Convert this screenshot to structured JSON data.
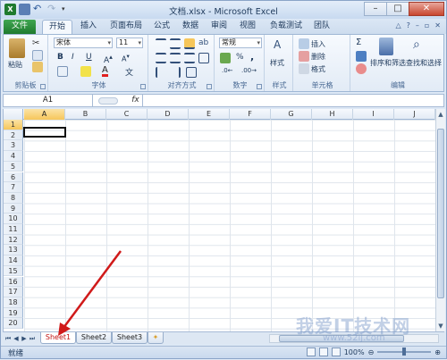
{
  "window": {
    "title": "文档.xlsx - Microsoft Excel",
    "buttons": {
      "minimize": "–",
      "maximize": "□",
      "close": "✕"
    }
  },
  "tabs": {
    "file": "文件",
    "items": [
      "开始",
      "插入",
      "页面布局",
      "公式",
      "数据",
      "审阅",
      "视图",
      "负载测试",
      "团队"
    ],
    "active": "开始"
  },
  "ribbon": {
    "clipboard": {
      "label": "剪贴板",
      "paste": "粘贴"
    },
    "font": {
      "label": "字体",
      "name": "宋体",
      "size": "11",
      "bold": "B",
      "italic": "I",
      "underline": "U"
    },
    "alignment": {
      "label": "对齐方式"
    },
    "number": {
      "label": "数字",
      "format": "常规",
      "percent": "%",
      "comma": ","
    },
    "styles": {
      "label": "样式",
      "button": "样式"
    },
    "cells": {
      "label": "单元格",
      "insert": "插入",
      "delete": "删除",
      "format": "格式"
    },
    "editing": {
      "label": "编辑",
      "sort": "排序和筛选",
      "find": "查找和选择",
      "sigma": "Σ"
    }
  },
  "formula_bar": {
    "name_box": "A1",
    "fx": "fx",
    "value": ""
  },
  "grid": {
    "columns": [
      "A",
      "B",
      "C",
      "D",
      "E",
      "F",
      "G",
      "H",
      "I",
      "J"
    ],
    "rows": [
      "1",
      "2",
      "3",
      "4",
      "5",
      "6",
      "7",
      "8",
      "9",
      "10",
      "11",
      "12",
      "13",
      "14",
      "15",
      "16",
      "17",
      "18",
      "19",
      "20"
    ],
    "selected_cell": "A1"
  },
  "sheets": {
    "tabs": [
      "Sheet1",
      "Sheet2",
      "Sheet3"
    ],
    "active": "Sheet1"
  },
  "status": {
    "text": "就绪",
    "zoom": "100%"
  },
  "watermark": {
    "text": "我爱IT技术网",
    "url": "www.52ij.com"
  },
  "colors": {
    "file_tab": "#2a8a3c",
    "arrow": "#d01a1a",
    "active_sheet_text": "#c21313"
  }
}
